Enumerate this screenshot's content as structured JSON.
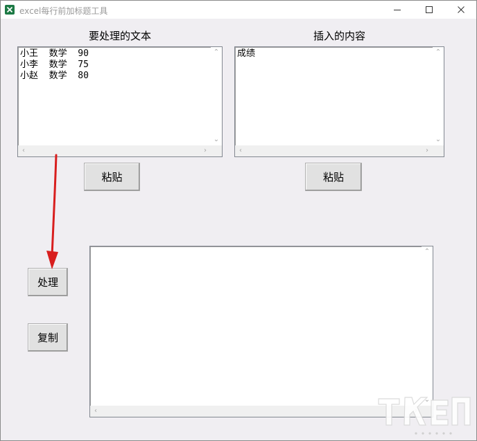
{
  "window": {
    "title": "excel每行前加标题工具",
    "controls": {
      "minimize_icon": "minimize-icon",
      "maximize_icon": "maximize-icon",
      "close_icon": "close-icon"
    }
  },
  "source_panel": {
    "label": "要处理的文本",
    "content": "小王  数学  90\n小李  数学  75\n小赵  数学  80",
    "paste_label": "粘贴"
  },
  "insert_panel": {
    "label": "插入的内容",
    "content": "成绩",
    "paste_label": "粘贴"
  },
  "actions": {
    "process_label": "处理",
    "copy_label": "复制"
  },
  "output_panel": {
    "content": ""
  },
  "colors": {
    "background": "#f0eef2",
    "annotation_arrow": "#d81e1e",
    "app_icon": "#1d7a45"
  }
}
